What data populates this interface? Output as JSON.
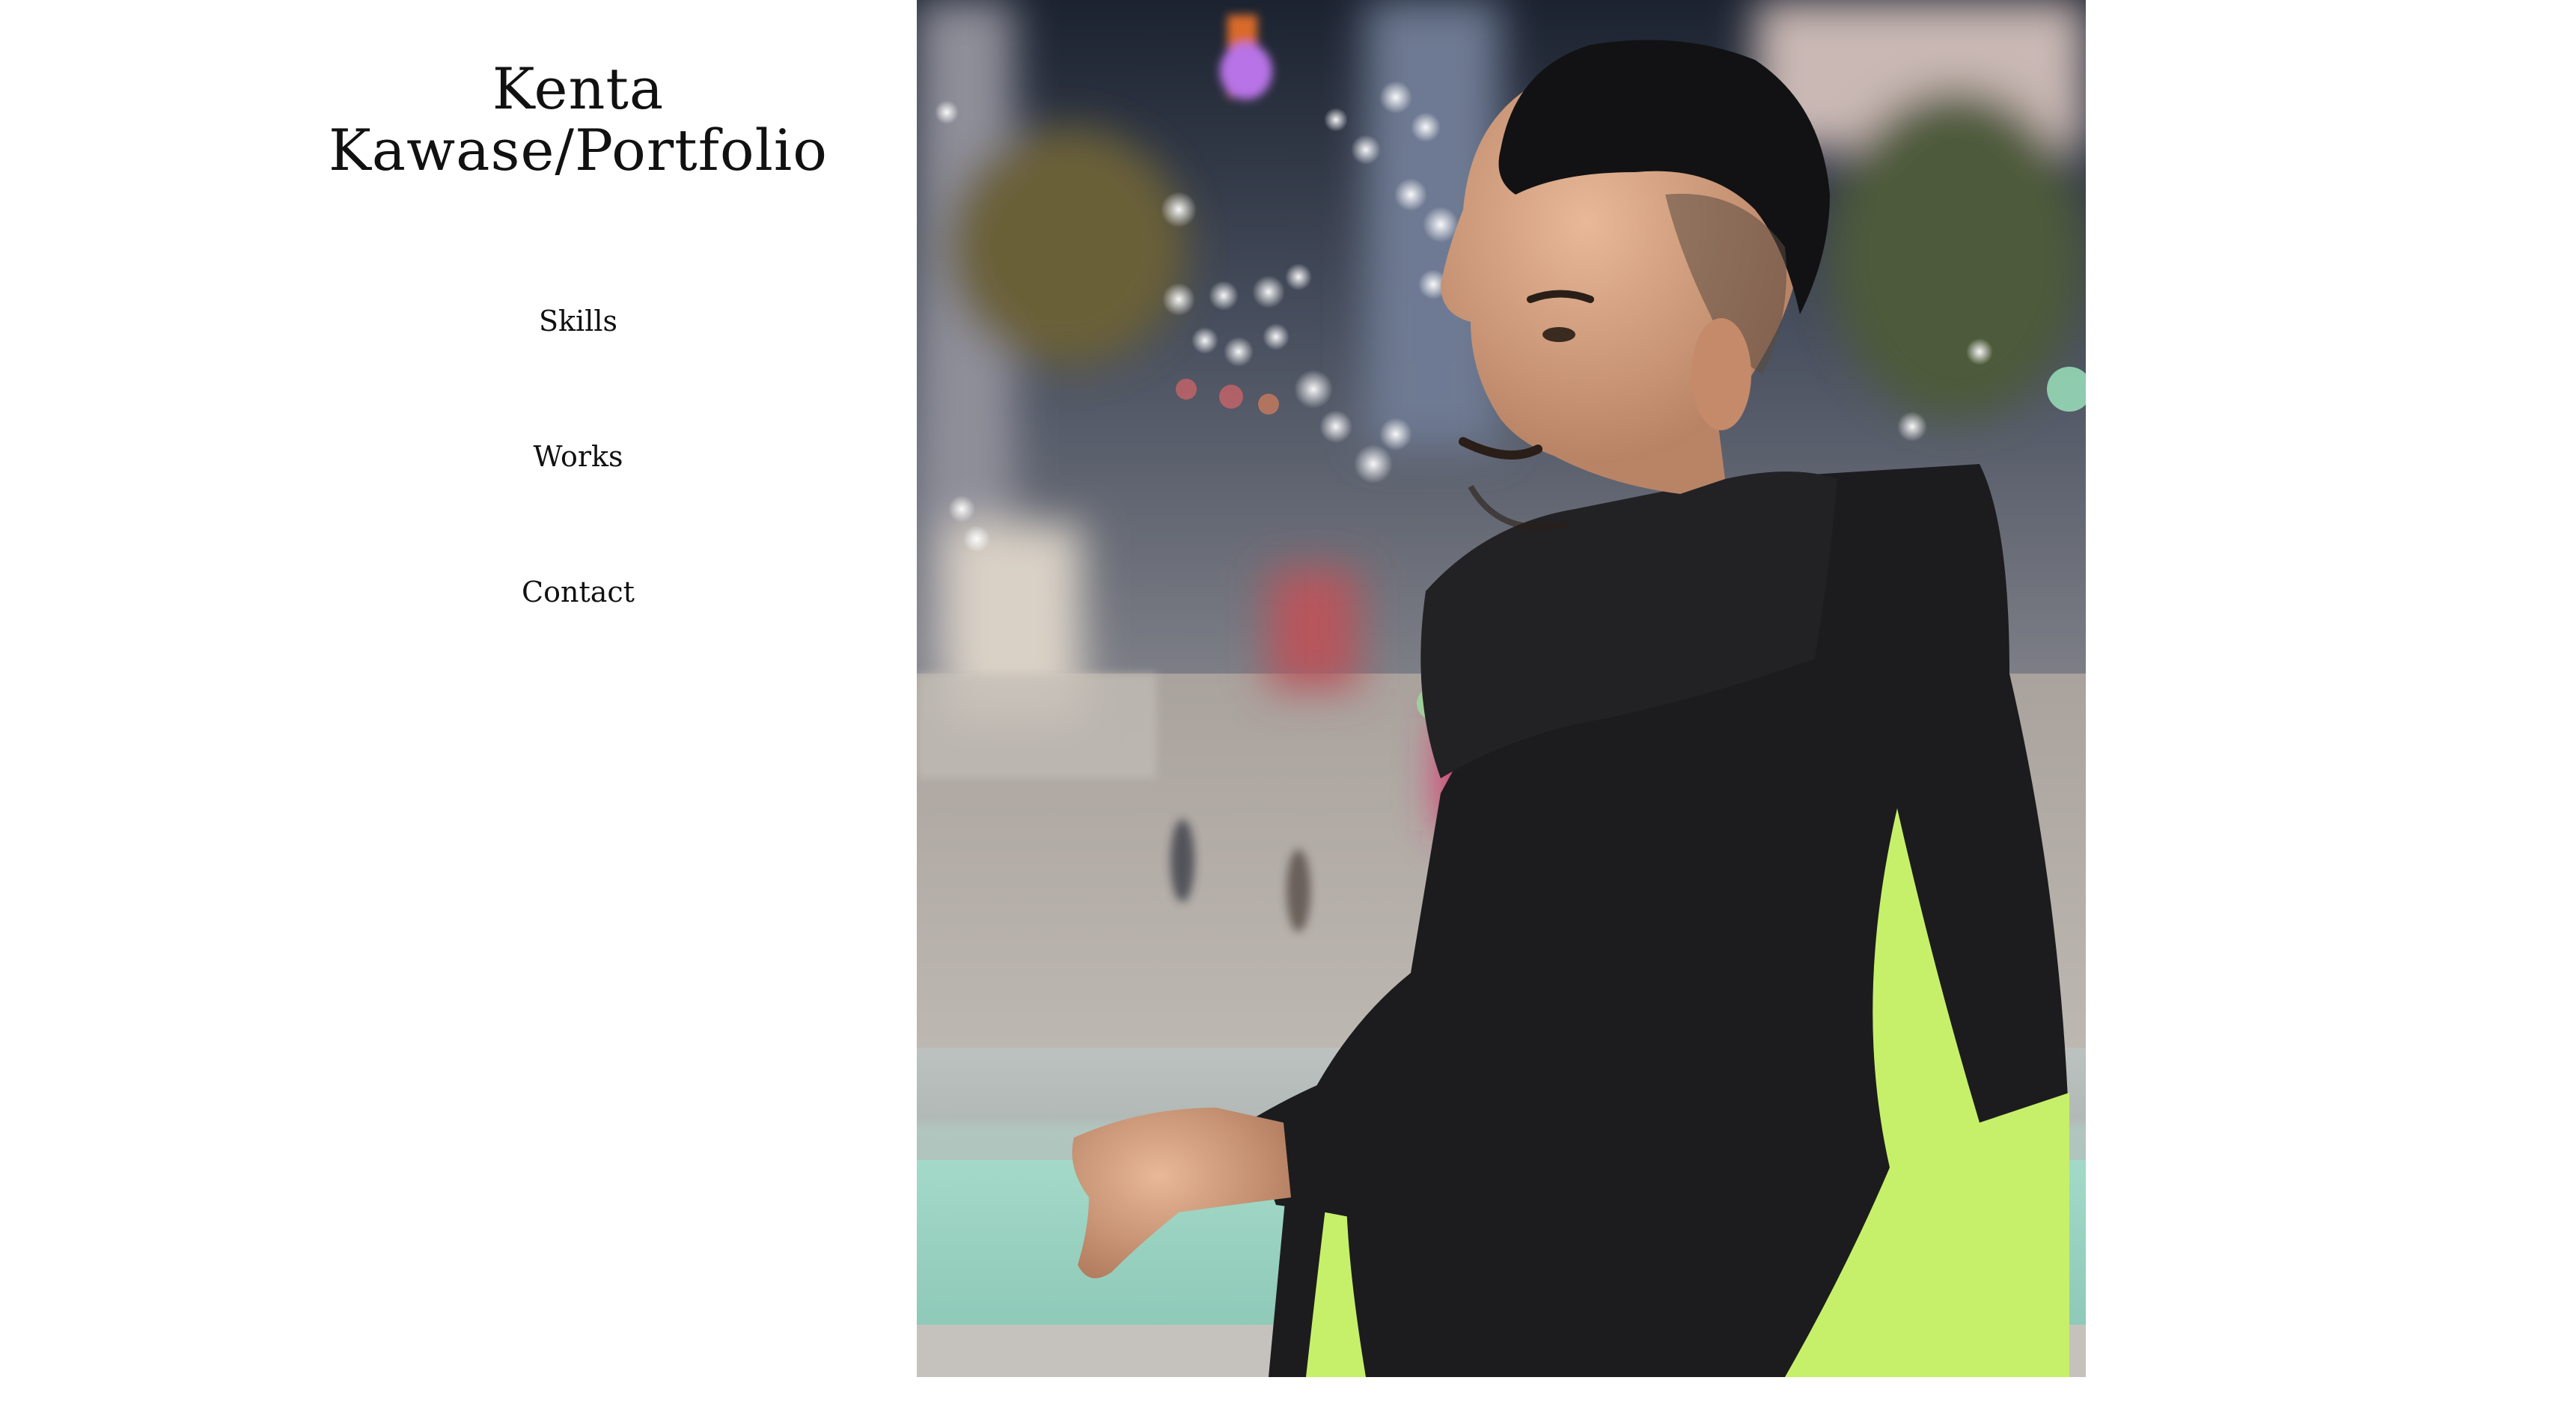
{
  "site": {
    "title_line1": "Kenta",
    "title_line2": "Kawase/Portfolio"
  },
  "nav": {
    "items": [
      {
        "label": "Skills"
      },
      {
        "label": "Works"
      },
      {
        "label": "Contact"
      }
    ]
  },
  "hero": {
    "subject": "portrait of man in black and neon green fleece jacket, night city street background"
  },
  "colors": {
    "background": "#ffffff",
    "text": "#111111",
    "jacket_black": "#1c1c1e",
    "jacket_green": "#c7f06a",
    "sky": "#1b2230",
    "railing": "#9fd6c6"
  }
}
